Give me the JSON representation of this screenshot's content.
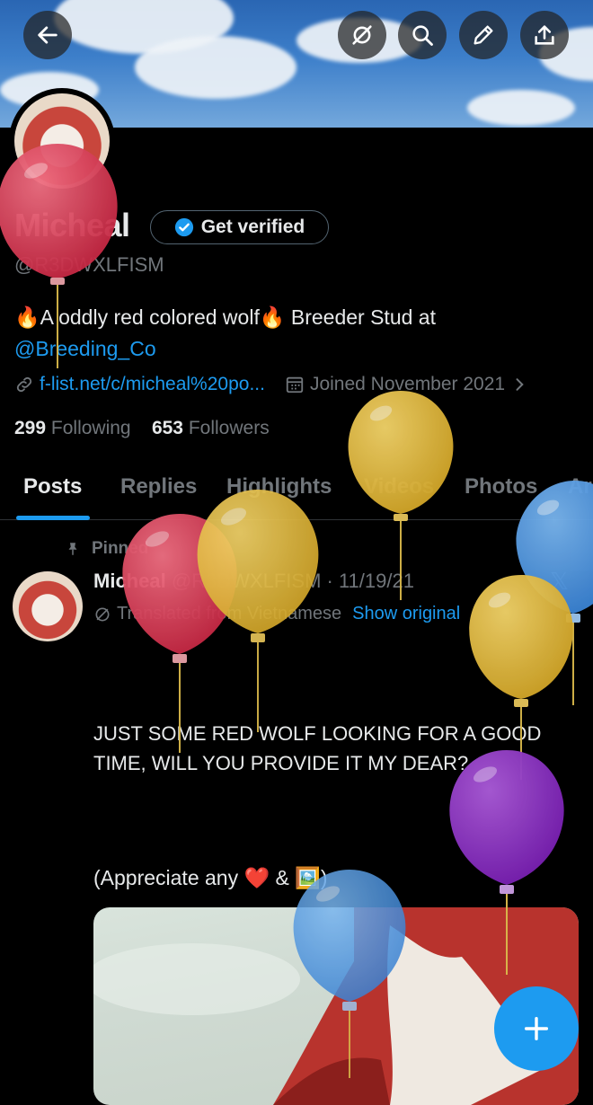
{
  "header": {
    "back_icon": "arrow-left-icon",
    "actions": [
      "no-location-icon",
      "search-icon",
      "edit-icon",
      "share-icon"
    ]
  },
  "profile": {
    "name": "Micheal",
    "verify_label": "Get verified",
    "handle": "@R3DWXLFISM",
    "bio_text": "A oddly red colored wolf",
    "bio_text_2": "Breeder Stud at",
    "bio_mention": "@Breeding_Co",
    "website": "f-list.net/c/micheal%20po...",
    "joined": "Joined November 2021",
    "following_count": "299",
    "following_label": "Following",
    "followers_count": "653",
    "followers_label": "Followers"
  },
  "tabs": [
    "Posts",
    "Replies",
    "Highlights",
    "Videos",
    "Photos",
    "Ar"
  ],
  "post": {
    "pinned_label": "Pinned",
    "author": "Micheal",
    "handle_date": "@R3DWXLFISM · 11/19/21",
    "translated_label": "Translated from Vietnamese",
    "show_original": "Show original",
    "text": "JUST SOME RED WOLF LOOKING FOR A GOOD TIME, WILL YOU PROVIDE IT MY DEAR?",
    "appreciate": "(Appreciate any ❤️ & 🖼️)"
  },
  "colors": {
    "accent": "#1d9bf0",
    "balloon_red": "#d43c56",
    "balloon_yellow": "#e2b83c",
    "balloon_blue": "#4f98e0",
    "balloon_purple": "#8a2dc2"
  }
}
